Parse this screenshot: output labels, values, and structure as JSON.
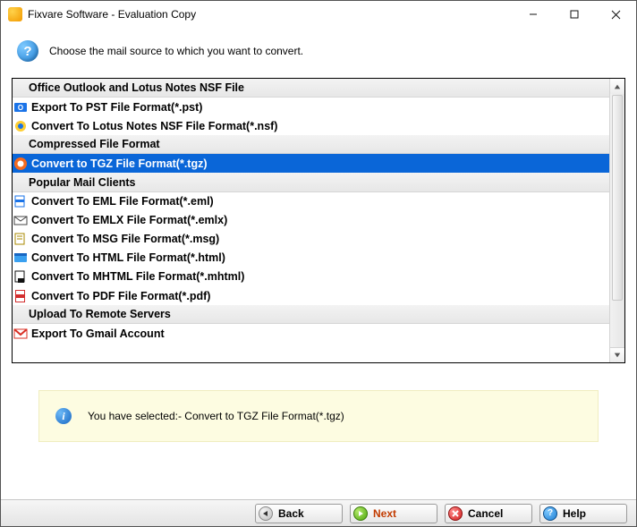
{
  "window": {
    "title": "Fixvare Software - Evaluation Copy"
  },
  "header": {
    "prompt": "Choose the mail source to which you want to convert."
  },
  "list": {
    "groups": [
      {
        "title": "Office Outlook and Lotus Notes NSF File"
      },
      {
        "title": "Compressed File Format"
      },
      {
        "title": "Popular Mail Clients"
      },
      {
        "title": "Upload To Remote Servers"
      }
    ],
    "items": {
      "pst": "Export To PST File Format(*.pst)",
      "nsf": "Convert To Lotus Notes NSF File Format(*.nsf)",
      "tgz": "Convert to TGZ File Format(*.tgz)",
      "eml": "Convert To EML File Format(*.eml)",
      "emlx": "Convert To EMLX File Format(*.emlx)",
      "msg": "Convert To MSG File Format(*.msg)",
      "html": "Convert To HTML File Format(*.html)",
      "mhtml": "Convert To MHTML File Format(*.mhtml)",
      "pdf": "Convert To PDF File Format(*.pdf)",
      "gmail": "Export To Gmail Account"
    }
  },
  "status": {
    "text": "You have selected:- Convert to TGZ File Format(*.tgz)"
  },
  "buttons": {
    "back": "Back",
    "next": "Next",
    "cancel": "Cancel",
    "help": "Help"
  }
}
